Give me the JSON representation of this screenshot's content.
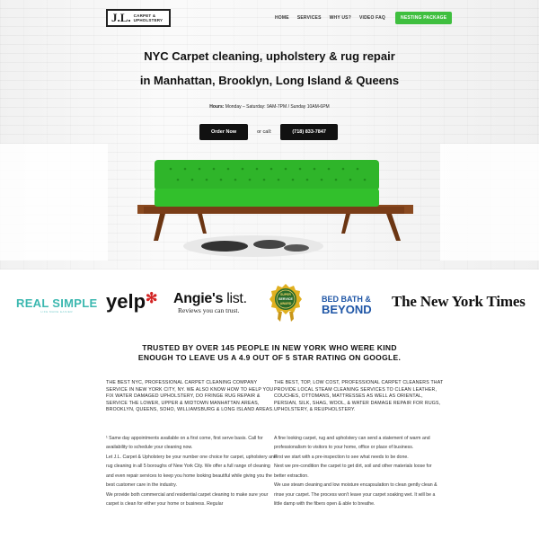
{
  "logo": {
    "mark": "J.L.",
    "subtitle": "CARPET & UPHOLSTERY"
  },
  "nav": {
    "items": [
      "HOME",
      "SERVICES",
      "WHY US?",
      "VIDEO FAQ"
    ],
    "cta": "NESTING PACKAGE"
  },
  "hero": {
    "title_line1": "NYC Carpet cleaning, upholstery & rug repair",
    "title_line2": "in Manhattan, Brooklyn, Long Island & Queens",
    "hours_label": "Hours:",
    "hours_text": " Monday – Saturday: 9AM-7PM / Sunday 10AM-6PM",
    "order_button": "Order Now",
    "or_call": "or call:",
    "phone_button": "(718) 833-7847"
  },
  "brands": {
    "real_simple": "REAL SIMPLE",
    "real_simple_tag": "LIFE MADE EASIER",
    "yelp": "yelp",
    "angies_main": "Angie's",
    "angies_list": " list.",
    "angies_sub": "Reviews you can trust.",
    "seal_top": "SUPER",
    "seal_mid": "SERVICE",
    "seal_bottom": "AWARD",
    "bbb_line1": "BED BATH &",
    "bbb_line2": "BEYOND",
    "nyt": "The New York Times"
  },
  "trust": {
    "line1": "TRUSTED BY OVER 145 PEOPLE IN NEW YORK WHO WERE KIND",
    "line2": "ENOUGH TO LEAVE US A 4.9 OUT OF 5 STAR RATING ON GOOGLE."
  },
  "left_column": {
    "heading": "THE BEST NYC, PROFESSIONAL CARPET CLEANING COMPANY SERVICE IN NEW YORK CITY, NY. WE ALSO KNOW HOW TO HELP YOU FIX WATER DAMAGED UPHOLSTERY, DO FRINGE RUG REPAIR & SERVICE THE LOWER, UPPER & MIDTOWN MANHATTAN AREAS, BROOKLYN, QUEENS, SOHO, WILLIAMSBURG & LONG ISLAND AREAS.",
    "p1": "¹ Same day appointments available on a first come, first serve basis. Call for availability to schedule your cleaning now.",
    "p2": "Let J.L. Carpet & Upholstery be your number one choice for carpet, upholstery and rug cleaning in all 5 boroughs of New York City. We offer a full range of cleaning and even repair services to keep you home looking beautiful while giving you the best customer care in the industry.",
    "p3": "We provide both commercial and residential carpet cleaning to make sure your carpet is clean for either your home or business. Regular"
  },
  "right_column": {
    "heading": "THE BEST, TOP, LOW COST, PROFESSIONAL CARPET CLEANERS THAT PROVIDE LOCAL STEAM CLEANING SERVICES TO CLEAN LEATHER, COUCHES, OTTOMANS, MATTRESSES AS WELL AS ORIENTAL, PERSIAN, SILK, SHAG, WOOL, & WATER DAMAGE REPAIR FOR RUGS, UPHOLSTERY, & REUPHOLSTERY.",
    "p1": "A fine looking carpet, rug and upholstery can send a statement of warm and professionalism to visitors to your home, office or place of business.",
    "p2": "First we start with a pre-inspection to see what needs to be done.",
    "p3": "Next we pre-condition the carpet to get dirt, soil and other materials loose for better extraction.",
    "p4": "We use steam cleaning and low moisture encapsulation to clean gently clean & rinse your carpet. The process won't leave your carpet soaking wet. It will be a little damp with the fibers open & able to breathe."
  },
  "colors": {
    "accent_green": "#3fbf3f",
    "sofa_green": "#2fb52a",
    "real_simple": "#3cb8b0",
    "yelp_red": "#d32323",
    "bbb_blue": "#1f56a6"
  }
}
